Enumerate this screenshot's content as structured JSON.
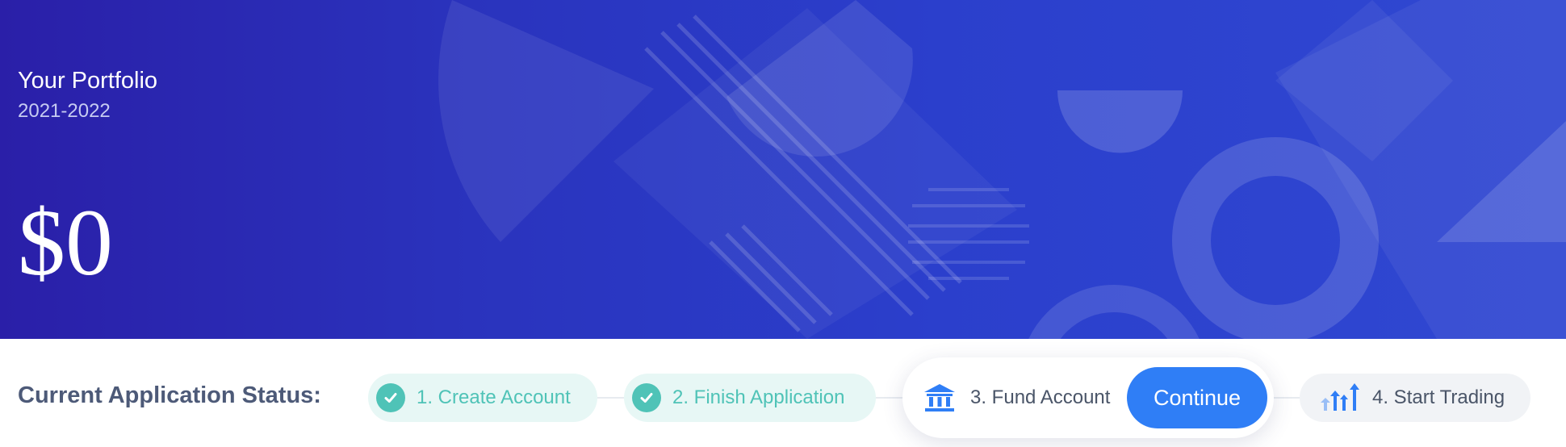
{
  "hero": {
    "title": "Your Portfolio",
    "subtitle": "2021-2022",
    "value": "$0"
  },
  "status": {
    "label": "Current Application Status:",
    "steps": [
      {
        "label": "1. Create Account",
        "state": "complete",
        "icon": "check-icon"
      },
      {
        "label": "2. Finish Application",
        "state": "complete",
        "icon": "check-icon"
      },
      {
        "label": "3. Fund Account",
        "state": "current",
        "icon": "bank-icon"
      },
      {
        "label": "4. Start Trading",
        "state": "pending",
        "icon": "trading-arrows-icon"
      }
    ],
    "continue_label": "Continue"
  },
  "colors": {
    "hero_bg": "#2b33bd",
    "complete_teal": "#4fc3b7",
    "complete_bg": "#e7f7f5",
    "accent_blue": "#2f7ef6",
    "text_slate": "#4d5a78"
  }
}
